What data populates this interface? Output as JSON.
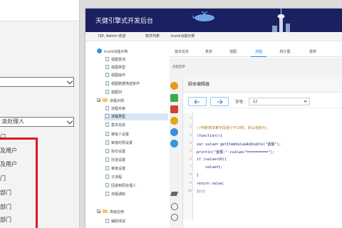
{
  "app": {
    "title": "天健引擎式开发后台"
  },
  "breadcrumb": {
    "user": "ISP, Admin 欢迎",
    "menu_a": "软件列表",
    "menu_b": "trunk功能示例"
  },
  "background_dialog": {
    "assign_label": "派处理人",
    "red_items": [
      "门",
      "及用户",
      "及用户",
      "门",
      "部门",
      "部门",
      "部门",
      "部门"
    ]
  },
  "sidebar": {
    "root": "trunk功能示例",
    "items": [
      {
        "label": "视图查询",
        "type": "doc"
      },
      {
        "label": "视图类型",
        "type": "doc"
      },
      {
        "label": "视图操作",
        "type": "doc"
      },
      {
        "label": "视图数据筛选条件",
        "type": "doc"
      },
      {
        "label": "视图列",
        "type": "doc"
      },
      {
        "label": "流程示例",
        "type": "folder-open"
      },
      {
        "label": "流程手册",
        "type": "doc"
      },
      {
        "label": "流程类型",
        "type": "doc",
        "active": true
      },
      {
        "label": "基本信息",
        "type": "doc"
      },
      {
        "label": "审批人设置",
        "type": "doc"
      },
      {
        "label": "审批时限设置",
        "type": "doc"
      },
      {
        "label": "协办设置",
        "type": "doc"
      },
      {
        "label": "抄送设置",
        "type": "doc"
      },
      {
        "label": "审批设置",
        "type": "doc"
      },
      {
        "label": "子流程",
        "type": "doc"
      },
      {
        "label": "回退到原处理人",
        "type": "doc"
      },
      {
        "label": "流程通知",
        "type": "doc"
      },
      {
        "label": "高级应用",
        "type": "folder-open"
      },
      {
        "label": "辅助测试",
        "type": "doc"
      }
    ]
  },
  "tabs": [
    "基本信息",
    "表单",
    "视图",
    "流程",
    "统计图",
    "报表"
  ],
  "active_tab_index": 3,
  "panel": {
    "title": "流程连带"
  },
  "editor": {
    "title": "脚本编辑器",
    "font_size_label": "字号:",
    "font_size_value": "12",
    "lines": [
      {
        "n": "1",
        "html": ""
      },
      {
        "n": "2",
        "text": "//判断表单某字段值小于10时，默认值就为；"
      },
      {
        "n": "3",
        "text": "(function(){"
      },
      {
        "n": "4",
        "text": "var value= getItemValueAsDouble(\"金额\");"
      },
      {
        "n": "5",
        "text": "println(\"金额:\" +value+\"==========\");"
      },
      {
        "n": "6",
        "text": "if (value<10){"
      },
      {
        "n": "7",
        "text": "    value=1;"
      },
      {
        "n": "8",
        "text": "}"
      },
      {
        "n": "9",
        "text": "return value;"
      },
      {
        "n": "10",
        "text": "})()"
      }
    ]
  },
  "colors": {
    "header_bg": "#1a2060",
    "accent": "#1e88e5",
    "highlight_border": "#e0191f"
  }
}
